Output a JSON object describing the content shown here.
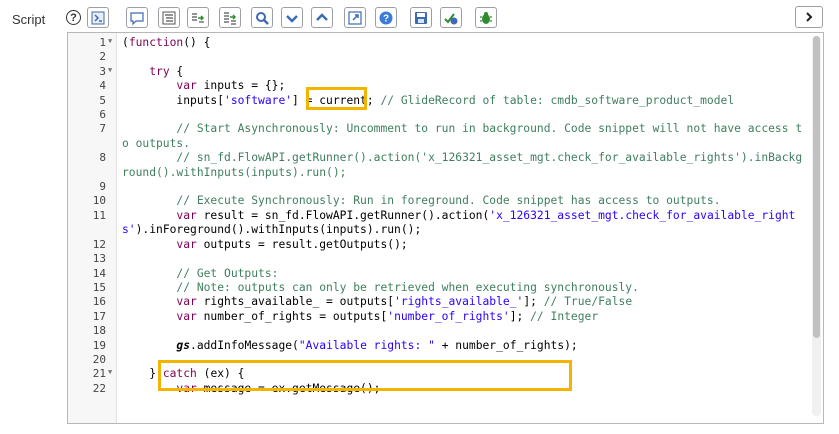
{
  "field": {
    "label": "Script"
  },
  "toolbar": {
    "help_glyph": "?",
    "buttons": [
      {
        "name": "script-include-icon"
      },
      {
        "name": "comment-icon"
      },
      {
        "name": "format-code-icon"
      },
      {
        "name": "replace-icon"
      },
      {
        "name": "replace-all-icon"
      },
      {
        "name": "search-icon"
      },
      {
        "name": "toggle-down-icon"
      },
      {
        "name": "toggle-up-icon"
      },
      {
        "name": "fullscreen-icon"
      },
      {
        "name": "help-icon"
      },
      {
        "name": "save-icon"
      },
      {
        "name": "syntax-check-icon"
      },
      {
        "name": "debug-icon"
      }
    ],
    "expand_glyph": "›"
  },
  "editor": {
    "lines": [
      {
        "n": "1",
        "fold": true,
        "html": "(<span class=\"kw\">function</span>() {"
      },
      {
        "n": "2",
        "fold": false,
        "html": ""
      },
      {
        "n": "3",
        "fold": true,
        "html": "    <span class=\"kw\">try</span> {"
      },
      {
        "n": "4",
        "fold": false,
        "html": "        <span class=\"kw\">var</span> inputs = {};"
      },
      {
        "n": "5",
        "fold": false,
        "html": "        inputs[<span class=\"str\">'software'</span>] = current; <span class=\"cm\">// GlideRecord of table: cmdb_software_product_model</span>"
      },
      {
        "n": "6",
        "fold": false,
        "html": ""
      },
      {
        "n": "7",
        "fold": false,
        "html": "        <span class=\"cm\">// Start Asynchronously: Uncomment to run in background. Code snippet will not have access to outputs.</span>"
      },
      {
        "n": "8",
        "fold": false,
        "html": "        <span class=\"cm\">// sn_fd.FlowAPI.getRunner().action('x_126321_asset_mgt.check_for_available_rights').inBackground().withInputs(inputs).run();</span>"
      },
      {
        "n": "9",
        "fold": false,
        "html": ""
      },
      {
        "n": "10",
        "fold": false,
        "html": "        <span class=\"cm\">// Execute Synchronously: Run in foreground. Code snippet has access to outputs.</span>"
      },
      {
        "n": "11",
        "fold": false,
        "html": "        <span class=\"kw\">var</span> result = sn_fd.FlowAPI.getRunner().action(<span class=\"str\">'x_126321_asset_mgt.check_for_available_rights'</span>).inForeground().withInputs(inputs).run();"
      },
      {
        "n": "12",
        "fold": false,
        "html": "        <span class=\"kw\">var</span> outputs = result.getOutputs();"
      },
      {
        "n": "13",
        "fold": false,
        "html": ""
      },
      {
        "n": "14",
        "fold": false,
        "html": "        <span class=\"cm\">// Get Outputs:</span>"
      },
      {
        "n": "15",
        "fold": false,
        "html": "        <span class=\"cm\">// Note: outputs can only be retrieved when executing synchronously.</span>"
      },
      {
        "n": "16",
        "fold": false,
        "html": "        <span class=\"kw\">var</span> rights_available_ = outputs[<span class=\"str\">'rights_available_'</span>]; <span class=\"cm\">// True/False</span>"
      },
      {
        "n": "17",
        "fold": false,
        "html": "        <span class=\"kw\">var</span> number_of_rights = outputs[<span class=\"str\">'number_of_rights'</span>]; <span class=\"cm\">// Integer</span>"
      },
      {
        "n": "18",
        "fold": false,
        "html": ""
      },
      {
        "n": "19",
        "fold": false,
        "html": "        <span class=\"gs\">gs</span>.addInfoMessage(<span class=\"str\">\"Available rights: \"</span> + number_of_rights);"
      },
      {
        "n": "20",
        "fold": false,
        "html": ""
      },
      {
        "n": "21",
        "fold": true,
        "html": "    } <span class=\"kw\">catch</span> (ex) {"
      },
      {
        "n": "22",
        "fold": false,
        "html": "        <span class=\"kw\">var</span> message = ex.getMessage();"
      }
    ]
  },
  "colors": {
    "highlight": "#f2b400",
    "keyword": "#7f0055",
    "string": "#2a00ff",
    "comment": "#3f7f5f"
  }
}
